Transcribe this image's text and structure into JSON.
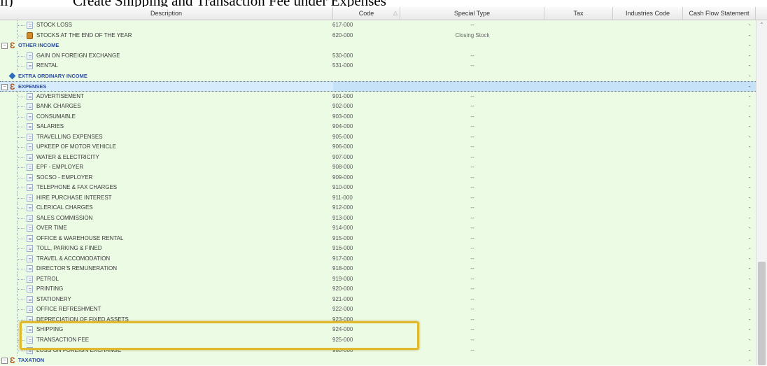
{
  "caption": {
    "number": "ii)",
    "text": "Create Shipping and Transaction Fee under Expenses"
  },
  "columns": {
    "description": "Description",
    "code": "Code",
    "special_type": "Special Type",
    "tax": "Tax",
    "industries_code": "Industries Code",
    "cash_flow": "Cash Flow Statement"
  },
  "rows": [
    {
      "label": "STOCK LOSS",
      "code": "617-000",
      "special": "--",
      "kind": "doc"
    },
    {
      "label": "STOCKS AT THE END OF THE YEAR",
      "code": "620-000",
      "special": "Closing Stock",
      "kind": "stock"
    },
    {
      "label": "OTHER INCOME",
      "code": "",
      "special": "",
      "kind": "group"
    },
    {
      "label": "GAIN ON FOREIGN EXCHANGE",
      "code": "530-000",
      "special": "--",
      "kind": "doc"
    },
    {
      "label": "RENTAL",
      "code": "531-000",
      "special": "--",
      "kind": "doc"
    },
    {
      "label": "EXTRA ORDINARY INCOME",
      "code": "",
      "special": "",
      "kind": "diamond"
    },
    {
      "label": "EXPENSES",
      "code": "",
      "special": "",
      "kind": "group-selected"
    },
    {
      "label": "ADVERTISEMENT",
      "code": "901-000",
      "special": "--",
      "kind": "doc"
    },
    {
      "label": "BANK CHARGES",
      "code": "902-000",
      "special": "--",
      "kind": "doc"
    },
    {
      "label": "CONSUMABLE",
      "code": "903-000",
      "special": "--",
      "kind": "doc"
    },
    {
      "label": "SALARIES",
      "code": "904-000",
      "special": "--",
      "kind": "doc"
    },
    {
      "label": "TRAVELLING EXPENSES",
      "code": "905-000",
      "special": "--",
      "kind": "doc"
    },
    {
      "label": "UPKEEP OF MOTOR VEHICLE",
      "code": "906-000",
      "special": "--",
      "kind": "doc"
    },
    {
      "label": "WATER & ELECTRICITY",
      "code": "907-000",
      "special": "--",
      "kind": "doc"
    },
    {
      "label": "EPF - EMPLOYER",
      "code": "908-000",
      "special": "--",
      "kind": "doc"
    },
    {
      "label": "SOCSO - EMPLOYER",
      "code": "909-000",
      "special": "--",
      "kind": "doc"
    },
    {
      "label": "TELEPHONE & FAX CHARGES",
      "code": "910-000",
      "special": "--",
      "kind": "doc"
    },
    {
      "label": "HIRE PURCHASE INTEREST",
      "code": "911-000",
      "special": "--",
      "kind": "doc"
    },
    {
      "label": "CLERICAL CHARGES",
      "code": "912-000",
      "special": "--",
      "kind": "doc"
    },
    {
      "label": "SALES COMMISSION",
      "code": "913-000",
      "special": "--",
      "kind": "doc"
    },
    {
      "label": "OVER TIME",
      "code": "914-000",
      "special": "--",
      "kind": "doc"
    },
    {
      "label": "OFFICE & WAREHOUSE RENTAL",
      "code": "915-000",
      "special": "--",
      "kind": "doc"
    },
    {
      "label": "TOLL, PARKING & FINED",
      "code": "916-000",
      "special": "--",
      "kind": "doc"
    },
    {
      "label": "TRAVEL & ACCOMODATION",
      "code": "917-000",
      "special": "--",
      "kind": "doc"
    },
    {
      "label": "DIRECTOR'S REMUNERATION",
      "code": "918-000",
      "special": "--",
      "kind": "doc"
    },
    {
      "label": "PETROL",
      "code": "919-000",
      "special": "--",
      "kind": "doc"
    },
    {
      "label": "PRINTING",
      "code": "920-000",
      "special": "--",
      "kind": "doc"
    },
    {
      "label": "STATIONERY",
      "code": "921-000",
      "special": "--",
      "kind": "doc"
    },
    {
      "label": "OFFICE REFRESHMENT",
      "code": "922-000",
      "special": "--",
      "kind": "doc"
    },
    {
      "label": "DEPRECIATION OF FIXED ASSETS",
      "code": "923-000",
      "special": "--",
      "kind": "doc"
    },
    {
      "label": "SHIPPING",
      "code": "924-000",
      "special": "--",
      "kind": "doc"
    },
    {
      "label": "TRANSACTION FEE",
      "code": "925-000",
      "special": "--",
      "kind": "doc"
    },
    {
      "label": "LOSS ON FOREIGN EXCHANGE",
      "code": "980-000",
      "special": "--",
      "kind": "doc"
    },
    {
      "label": "TAXATION",
      "code": "",
      "special": "",
      "kind": "group"
    }
  ],
  "cash_flow_placeholder": "-",
  "highlight_color": "#e1b92c",
  "row_bg": "#ecfbe4",
  "selected_bg": "#c6e2f8"
}
